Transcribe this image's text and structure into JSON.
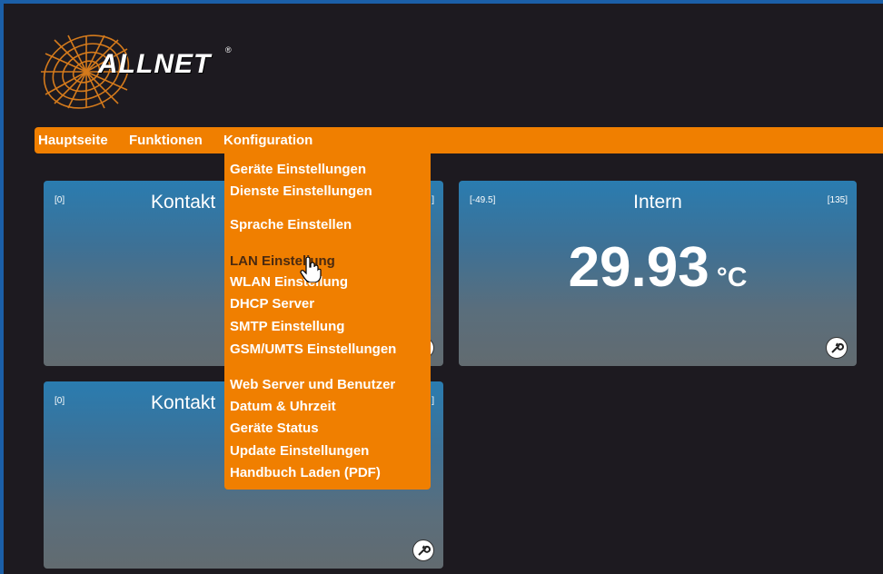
{
  "brand": {
    "name": "ALLNET",
    "registered": "®"
  },
  "nav": [
    {
      "label": "Hauptseite"
    },
    {
      "label": "Funktionen"
    },
    {
      "label": "Konfiguration"
    }
  ],
  "menu": {
    "items": [
      {
        "label": "Geräte Einstellungen"
      },
      {
        "label": "Dienste Einstellungen"
      },
      {
        "label": "Sprache Einstellen"
      },
      {
        "label": "LAN Einstellung"
      },
      {
        "label": "WLAN Einstellung"
      },
      {
        "label": "DHCP Server"
      },
      {
        "label": "SMTP Einstellung"
      },
      {
        "label": "GSM/UMTS Einstellungen"
      },
      {
        "label": "Web Server und Benutzer"
      },
      {
        "label": "Datum & Uhrzeit"
      },
      {
        "label": "Geräte Status"
      },
      {
        "label": "Update Einstellungen"
      },
      {
        "label": "Handbuch Laden (PDF)"
      }
    ],
    "hovered": "LAN Einstellung"
  },
  "tiles": [
    {
      "title": "Kontakt",
      "min": "[0]",
      "max": "]"
    },
    {
      "title": "Intern",
      "min": "[-49.5]",
      "max": "[135]",
      "value": "29.93",
      "unit": "°C"
    },
    {
      "title": "Kontakt",
      "min": "[0]",
      "max": "]"
    }
  ],
  "colors": {
    "accent": "#f07f00",
    "frame": "#1b5fa8",
    "background": "#1d1a20"
  },
  "icons": {
    "settings": "wrench-icon",
    "pointer": "hand-cursor-icon"
  }
}
